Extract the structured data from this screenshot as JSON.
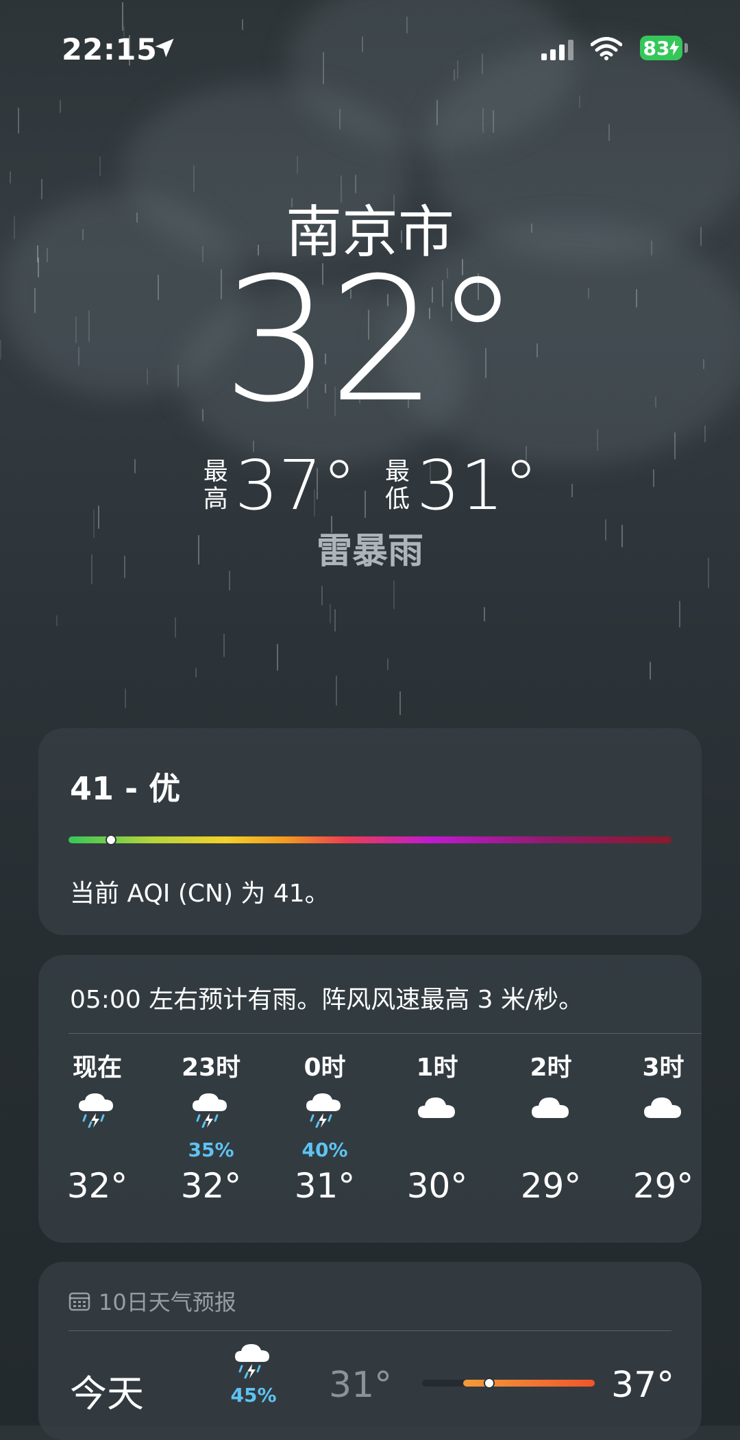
{
  "status_bar": {
    "time": "22:15",
    "battery": "83"
  },
  "hero": {
    "city": "南京市",
    "temperature": "32°",
    "high_label": "最高",
    "high": "37°",
    "low_label": "最低",
    "low": "31°",
    "condition": "雷暴雨"
  },
  "aqi": {
    "title": "41 - 优",
    "description": "当前 AQI (CN) 为 41。",
    "value_fraction": 0.07
  },
  "hourly": {
    "summary": "05:00 左右预计有雨。阵风风速最高 3 米/秒。",
    "items": [
      {
        "label": "现在",
        "icon": "thunderstorm-icon",
        "pop": "",
        "temp": "32°"
      },
      {
        "label": "23时",
        "icon": "thunderstorm-icon",
        "pop": "35%",
        "temp": "32°"
      },
      {
        "label": "0时",
        "icon": "thunderstorm-icon",
        "pop": "40%",
        "temp": "31°"
      },
      {
        "label": "1时",
        "icon": "cloud-icon",
        "pop": "",
        "temp": "30°"
      },
      {
        "label": "2时",
        "icon": "cloud-icon",
        "pop": "",
        "temp": "29°"
      },
      {
        "label": "3时",
        "icon": "cloud-icon",
        "pop": "",
        "temp": "29°"
      }
    ]
  },
  "daily": {
    "header": "10日天气预报",
    "today": {
      "name": "今天",
      "icon": "thunderstorm-icon",
      "pop": "45%",
      "low": "31°",
      "high": "37°",
      "current_fraction": 0.2
    }
  },
  "colors": {
    "accent_blue": "#5ec3f2",
    "battery_green": "#35c759",
    "range_orange": "#f0552a"
  }
}
